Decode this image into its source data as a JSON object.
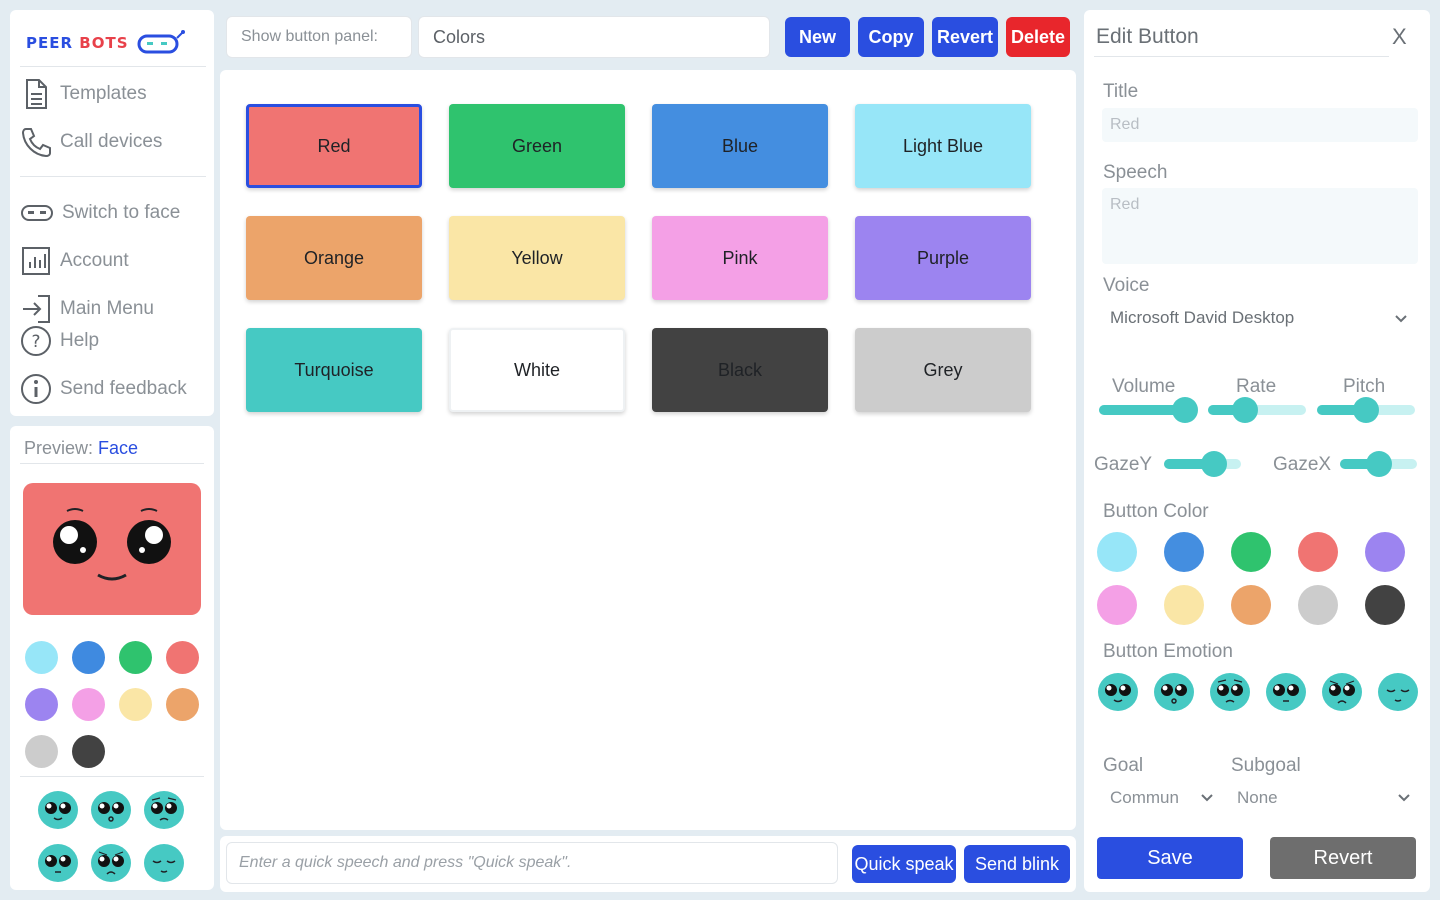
{
  "brand": {
    "name_part1": "PEER",
    "name_part2": "BOTS"
  },
  "sidebar": {
    "items": [
      {
        "label": "Templates",
        "icon": "document-icon"
      },
      {
        "label": "Call devices",
        "icon": "phone-icon"
      },
      {
        "label": "Switch to face",
        "icon": "face-mask-icon"
      },
      {
        "label": "Account",
        "icon": "chart-icon"
      },
      {
        "label": "Main Menu",
        "icon": "exit-icon"
      },
      {
        "label": "Help",
        "icon": "help-circle-icon"
      },
      {
        "label": "Send feedback",
        "icon": "info-circle-icon"
      }
    ]
  },
  "preview": {
    "label": "Preview:",
    "mode": "Face",
    "colors": [
      "#97e6f8",
      "#3f8ae0",
      "#2fc36e",
      "#f07472",
      "#9c84f0",
      "#f4a0e6",
      "#fae6a6",
      "#eca46a",
      "#cccccc",
      "#424242"
    ],
    "emotions": [
      "happy",
      "surprised",
      "worried",
      "neutral",
      "sad",
      "sleepy"
    ]
  },
  "toolbar": {
    "panel_label": "Show button panel:",
    "panel_value": "Colors",
    "new_label": "New",
    "copy_label": "Copy",
    "revert_label": "Revert",
    "delete_label": "Delete"
  },
  "grid": {
    "buttons": [
      {
        "label": "Red",
        "color": "#f07472",
        "selected": true
      },
      {
        "label": "Green",
        "color": "#2fc36e"
      },
      {
        "label": "Blue",
        "color": "#448ee0"
      },
      {
        "label": "Light Blue",
        "color": "#97e6f8"
      },
      {
        "label": "Orange",
        "color": "#eca46a"
      },
      {
        "label": "Yellow",
        "color": "#fae6a6"
      },
      {
        "label": "Pink",
        "color": "#f4a0e6"
      },
      {
        "label": "Purple",
        "color": "#9c84f0"
      },
      {
        "label": "Turquoise",
        "color": "#46c9c3"
      },
      {
        "label": "White",
        "color": "#ffffff"
      },
      {
        "label": "Black",
        "color": "#424242"
      },
      {
        "label": "Grey",
        "color": "#cccccc"
      }
    ]
  },
  "quick": {
    "placeholder": "Enter a quick speech and press \"Quick speak\".",
    "speak_label": "Quick speak",
    "blink_label": "Send blink"
  },
  "edit": {
    "title": "Edit Button",
    "close": "X",
    "title_label": "Title",
    "title_value": "Red",
    "speech_label": "Speech",
    "speech_value": "Red",
    "voice_label": "Voice",
    "voice_value": "Microsoft David Desktop",
    "volume_label": "Volume",
    "rate_label": "Rate",
    "pitch_label": "Pitch",
    "gazey_label": "GazeY",
    "gazex_label": "GazeX",
    "sliders": {
      "volume": 0.9,
      "rate": 0.38,
      "pitch": 0.5,
      "gazey": 0.65,
      "gazex": 0.5
    },
    "color_label": "Button Color",
    "colors": [
      "#97e6f8",
      "#448ee0",
      "#2fc36e",
      "#f07472",
      "#9c84f0",
      "#f4a0e6",
      "#fae6a6",
      "#eca46a",
      "#cccccc",
      "#424242"
    ],
    "emotion_label": "Button Emotion",
    "goal_label": "Goal",
    "goal_value": "Commun",
    "subgoal_label": "Subgoal",
    "subgoal_value": "None",
    "save_label": "Save",
    "revert_label": "Revert"
  },
  "theme": {
    "accent": "#2a4ee0",
    "danger": "#e8262c",
    "turquoise": "#46c9c3"
  }
}
